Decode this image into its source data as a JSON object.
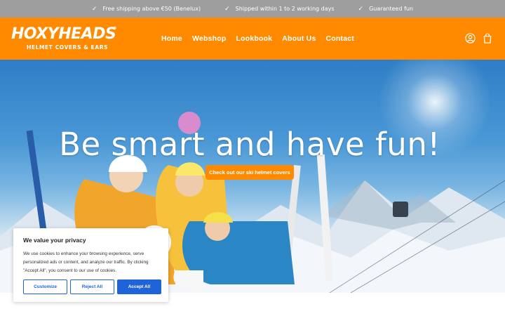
{
  "topbar": {
    "usps": [
      {
        "icon": "check-icon",
        "text": "Free shipping above €50 (Benelux)"
      },
      {
        "icon": "check-icon",
        "text": "Shipped within 1 to 2 working days"
      },
      {
        "icon": "check-icon",
        "text": "Guaranteed fun"
      }
    ]
  },
  "header": {
    "logo": {
      "brand": "HOXYHEADS",
      "tagline": "HELMET COVERS & EARS",
      "reg": "®"
    },
    "nav": [
      "Home",
      "Webshop",
      "Lookbook",
      "About Us",
      "Contact"
    ],
    "icons": [
      "account-icon",
      "cart-icon"
    ]
  },
  "hero": {
    "title": "Be smart and have fun!",
    "cta": "Check out our ski helmet covers"
  },
  "cookie": {
    "title": "We value your privacy",
    "text": "We use cookies to enhance your browsing experience, serve personalized ads or content, and analyze our traffic. By clicking \"Accept All\", you consent to our use of cookies.",
    "customize": "Customize",
    "reject": "Reject All",
    "accept": "Accept All"
  },
  "colors": {
    "accent": "#ff8a00",
    "topbar": "#9e9e9e",
    "cookie_button": "#1e63d7"
  }
}
